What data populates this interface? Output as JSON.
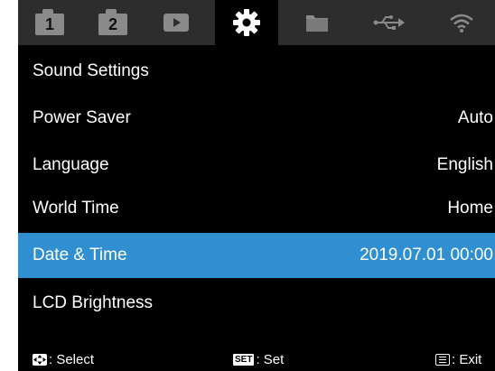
{
  "tabs": [
    {
      "icon": "camera-1-icon",
      "label": "1"
    },
    {
      "icon": "camera-2-icon",
      "label": "2"
    },
    {
      "icon": "playback-icon"
    },
    {
      "icon": "gear-icon"
    },
    {
      "icon": "folder-icon"
    },
    {
      "icon": "usb-icon"
    },
    {
      "icon": "wifi-icon"
    }
  ],
  "active_tab": 3,
  "menu": {
    "items": [
      {
        "label": "Sound Settings",
        "value": ""
      },
      {
        "label": "Power Saver",
        "value": "Auto"
      },
      {
        "label": "Language",
        "value": "English"
      },
      {
        "label": "World Time",
        "value": "Home"
      },
      {
        "label": "Date & Time",
        "value": "2019.07.01 00:00"
      },
      {
        "label": "LCD Brightness",
        "value": ""
      }
    ],
    "selected_index": 4
  },
  "footer": {
    "select_label": ": Select",
    "set_key": "SET",
    "set_label": ": Set",
    "exit_label": ": Exit"
  },
  "colors": {
    "background": "#000000",
    "tab_bar": "#2d2d2d",
    "icon": "#8a8a8a",
    "active_icon": "#ffffff",
    "highlight": "#2f8fd0",
    "text": "#ffffff"
  }
}
